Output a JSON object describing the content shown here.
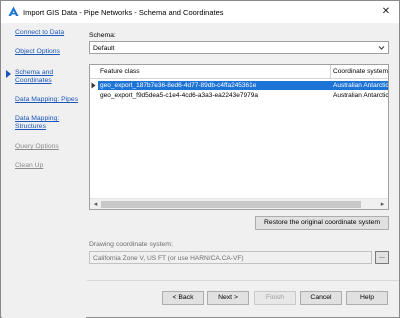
{
  "window": {
    "title": "Import GIS Data - Pipe Networks - Schema and Coordinates",
    "close_glyph": "✕"
  },
  "sidebar": {
    "items": [
      {
        "label": "Connect to Data",
        "state": "link"
      },
      {
        "label": "Object Options",
        "state": "link"
      },
      {
        "label": "Schema and Coordinates",
        "state": "active"
      },
      {
        "label": "Data Mapping: Pipes",
        "state": "link"
      },
      {
        "label": "Data Mapping: Structures",
        "state": "link"
      },
      {
        "label": "Query Options",
        "state": "disabled"
      },
      {
        "label": "Clean Up",
        "state": "disabled"
      }
    ]
  },
  "schema": {
    "label": "Schema:",
    "selected": "Default"
  },
  "grid": {
    "columns": [
      "Feature class",
      "Coordinate system"
    ],
    "rows": [
      {
        "feature_class": "geo_export_187b7e36-8ed6-4d77-89db-c4ffa245361e",
        "coordinate_system": "Australian Antarctic",
        "selected": true
      },
      {
        "feature_class": "geo_export_f9d5dea5-c1e4-4cd6-a3a3-ea2243e7979a",
        "coordinate_system": "Australian Antarctic",
        "selected": false
      }
    ],
    "scroll_left": "◂",
    "scroll_right": "▸"
  },
  "restore_button": "Restore the original coordinate system",
  "drawing_coords": {
    "label": "Drawing coordinate system:",
    "value": "California Zone V, US FT (or use HARN/CA.CA-VF)",
    "browse_label": "..."
  },
  "footer": {
    "back": "< Back",
    "next": "Next >",
    "finish": "Finish",
    "cancel": "Cancel",
    "help": "Help"
  },
  "colors": {
    "accent": "#1e74d6",
    "link": "#1a56b8",
    "disabled_text": "#8c8c8c"
  }
}
